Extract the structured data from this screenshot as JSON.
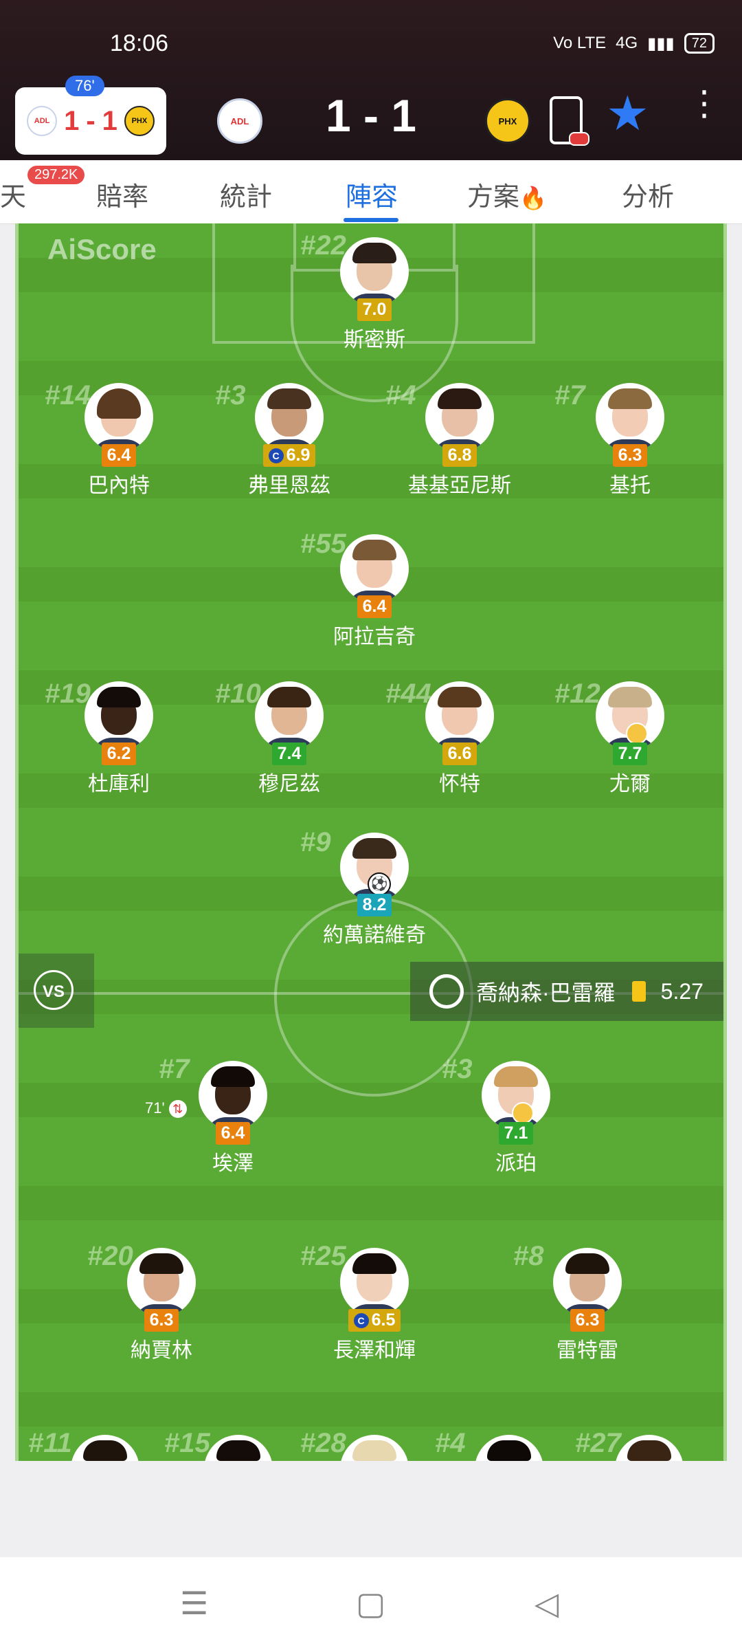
{
  "status_bar": {
    "time": "18:06",
    "volte": "Vo LTE",
    "network": "4G",
    "battery": "72"
  },
  "match": {
    "minute": "76'",
    "mini_home_score": "1",
    "mini_sep": "-",
    "mini_away_score": "1",
    "score": "1 - 1"
  },
  "tabs": {
    "items": [
      "天",
      "賠率",
      "統計",
      "陣容",
      "方案",
      "分析"
    ],
    "active": "陣容",
    "chat_count": "297.2K"
  },
  "pitch": {
    "watermark": "AiScore"
  },
  "home_players": [
    {
      "number": "#22",
      "rating": "7.0",
      "name": "斯密斯"
    },
    {
      "number": "#14",
      "rating": "6.4",
      "name": "巴內特"
    },
    {
      "number": "#3",
      "rating": "6.9",
      "name": "弗里恩茲",
      "captain": "C"
    },
    {
      "number": "#4",
      "rating": "6.8",
      "name": "基基亞尼斯"
    },
    {
      "number": "#7",
      "rating": "6.3",
      "name": "基托"
    },
    {
      "number": "#55",
      "rating": "6.4",
      "name": "阿拉吉奇"
    },
    {
      "number": "#19",
      "rating": "6.2",
      "name": "杜庫利"
    },
    {
      "number": "#10",
      "rating": "7.4",
      "name": "穆尼茲"
    },
    {
      "number": "#44",
      "rating": "6.6",
      "name": "怀特"
    },
    {
      "number": "#12",
      "rating": "7.7",
      "name": "尤爾"
    },
    {
      "number": "#9",
      "rating": "8.2",
      "name": "約萬諾維奇"
    }
  ],
  "away_players": [
    {
      "number": "#7",
      "rating": "6.4",
      "name": "埃澤",
      "sub_minute": "71'"
    },
    {
      "number": "#3",
      "rating": "7.1",
      "name": "派珀"
    },
    {
      "number": "#20",
      "rating": "6.3",
      "name": "納賈林"
    },
    {
      "number": "#25",
      "rating": "6.5",
      "name": "長澤和輝",
      "captain": "C"
    },
    {
      "number": "#8",
      "rating": "6.3",
      "name": "雷特雷"
    },
    {
      "number": "#11"
    },
    {
      "number": "#15"
    },
    {
      "number": "#28"
    },
    {
      "number": "#4"
    },
    {
      "number": "#27"
    }
  ],
  "vs_label": "VS",
  "referee": {
    "name": "喬納森·巴雷羅",
    "yellow_avg": "5.27"
  },
  "colors": {
    "pitch": "#5aaa36",
    "accent_blue": "#1e6fe0",
    "rating_orange": "#e8820c",
    "rating_yellow": "#d4a80c",
    "rating_green": "#2ea82e",
    "rating_teal": "#1aa6b8"
  },
  "icons": {
    "menu": "menu-icon",
    "home": "home-square-icon",
    "back": "back-triangle-icon",
    "favorite": "star-icon",
    "more": "more-vertical-icon"
  }
}
